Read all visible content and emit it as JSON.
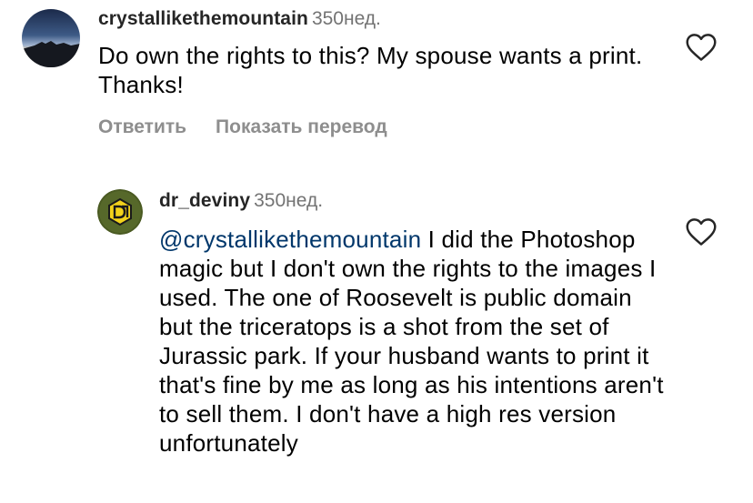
{
  "comments": [
    {
      "username": "crystallikethemountain",
      "time": "350нед.",
      "text": "Do own the rights to this? My spouse wants a print. Thanks!",
      "actions": {
        "reply": "Ответить",
        "translate": "Показать перевод"
      },
      "like_icon": "heart-outline-icon"
    },
    {
      "username": "dr_deviny",
      "time": "350нед.",
      "mention": "@crystallikethemountain",
      "text": " I did the Photoshop magic but I don't own the rights to the images I used. The one of Roosevelt is public domain but the triceratops is a shot from the set of Jurassic park. If your husband wants to print it that's fine by me as long as his intentions aren't to sell them. I don't have a high res version unfortunately",
      "like_icon": "heart-outline-icon"
    }
  ],
  "colors": {
    "username": "#262626",
    "timestamp": "#737373",
    "mention": "#00376b",
    "actions": "#8e8e8e"
  }
}
